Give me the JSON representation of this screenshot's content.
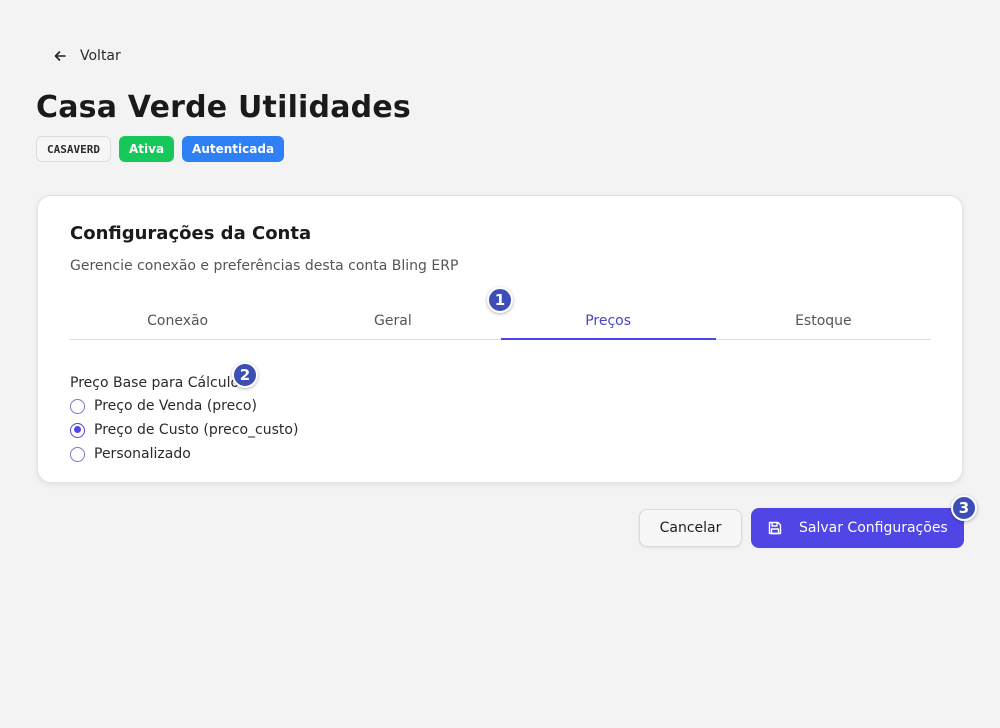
{
  "header": {
    "back_label": "Voltar",
    "title": "Casa Verde Utilidades",
    "badges": {
      "code": "CASAVERD",
      "status": "Ativa",
      "auth": "Autenticada"
    }
  },
  "card": {
    "title": "Configurações da Conta",
    "description": "Gerencie conexão e preferências desta conta Bling ERP",
    "tabs": [
      {
        "label": "Conexão",
        "active": false
      },
      {
        "label": "Geral",
        "active": false
      },
      {
        "label": "Preços",
        "active": true
      },
      {
        "label": "Estoque",
        "active": false
      }
    ],
    "price_base": {
      "label": "Preço Base para Cálculo",
      "options": [
        {
          "label": "Preço de Venda (preco)",
          "checked": false
        },
        {
          "label": "Preço de Custo (preco_custo)",
          "checked": true
        },
        {
          "label": "Personalizado",
          "checked": false
        }
      ]
    }
  },
  "actions": {
    "cancel_label": "Cancelar",
    "save_label": "Salvar Configurações"
  },
  "markers": [
    "1",
    "2",
    "3"
  ],
  "colors": {
    "accent": "#4f46e5",
    "status_active": "#16c75a",
    "status_auth": "#2f80f5",
    "marker": "#3d4fb5"
  },
  "icons": {
    "back": "arrow-left-icon",
    "save": "floppy-disk-icon"
  }
}
